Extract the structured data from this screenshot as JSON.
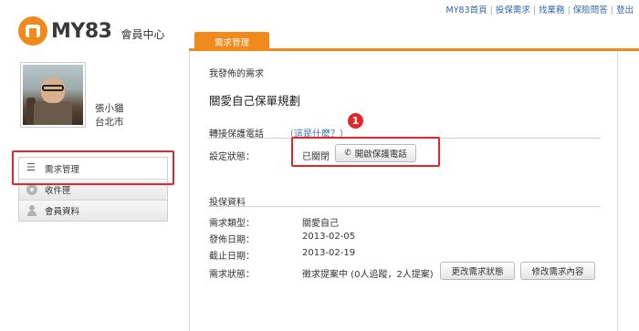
{
  "top_links": [
    "MY83首頁",
    "投保需求",
    "找業務",
    "保險問答",
    "登出"
  ],
  "logo": {
    "text": "MY83",
    "subtitle": "會員中心"
  },
  "user": {
    "name": "張小貓",
    "city": "台北市"
  },
  "sidebar": {
    "items": [
      {
        "label": "需求管理",
        "icon": "list-icon"
      },
      {
        "label": "收件匣",
        "icon": "gear-icon"
      },
      {
        "label": "會員資料",
        "icon": "user-icon"
      }
    ]
  },
  "tab": {
    "label": "需求管理"
  },
  "main": {
    "section_title": "我發佈的需求",
    "request_title": "關愛自己保單規劃",
    "transfer": {
      "heading": "轉接保護電話",
      "help_link": "（這是什麼？）",
      "status_label": "設定狀態：",
      "status_value": "已關閉",
      "open_button": "開啟保護電話"
    },
    "insurance": {
      "heading": "投保資料",
      "type_label": "需求類型：",
      "type_value": "關愛自己",
      "published_label": "發佈日期：",
      "published_value": "2013-02-05",
      "deadline_label": "截止日期：",
      "deadline_value": "2013-02-19",
      "status_label": "需求狀態：",
      "status_value": "徵求提案中 (0人追蹤，2人提案)",
      "change_status_button": "更改需求狀態",
      "edit_button": "修改需求內容"
    }
  },
  "annotation": {
    "badge": "1"
  },
  "colors": {
    "accent": "#f08a1c",
    "highlight": "#e8232a",
    "link": "#3a6fb6"
  }
}
